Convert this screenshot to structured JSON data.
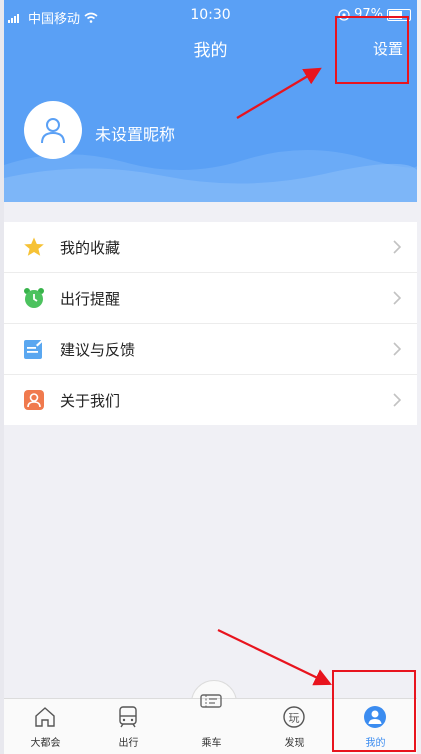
{
  "status_bar": {
    "carrier": "中国移动",
    "time": "10:30",
    "battery": "97%"
  },
  "header": {
    "title": "我的",
    "settings_label": "设置"
  },
  "profile": {
    "nickname": "未设置昵称"
  },
  "menu": {
    "items": [
      {
        "label": "我的收藏",
        "icon": "star-icon"
      },
      {
        "label": "出行提醒",
        "icon": "alarm-clock-icon"
      },
      {
        "label": "建议与反馈",
        "icon": "feedback-note-icon"
      },
      {
        "label": "关于我们",
        "icon": "person-icon"
      }
    ]
  },
  "tabbar": {
    "items": [
      {
        "label": "大都会",
        "icon": "home-icon"
      },
      {
        "label": "出行",
        "icon": "bus-icon"
      },
      {
        "label": "乘车",
        "icon": "ticket-icon"
      },
      {
        "label": "发现",
        "icon": "play-badge-icon",
        "glyph": "玩"
      },
      {
        "label": "我的",
        "icon": "user-circle-icon",
        "active": true
      }
    ]
  },
  "colors": {
    "header_blue": "#5aa0f5",
    "active_tab": "#3b8cf0",
    "annotation_red": "#e8141e"
  }
}
